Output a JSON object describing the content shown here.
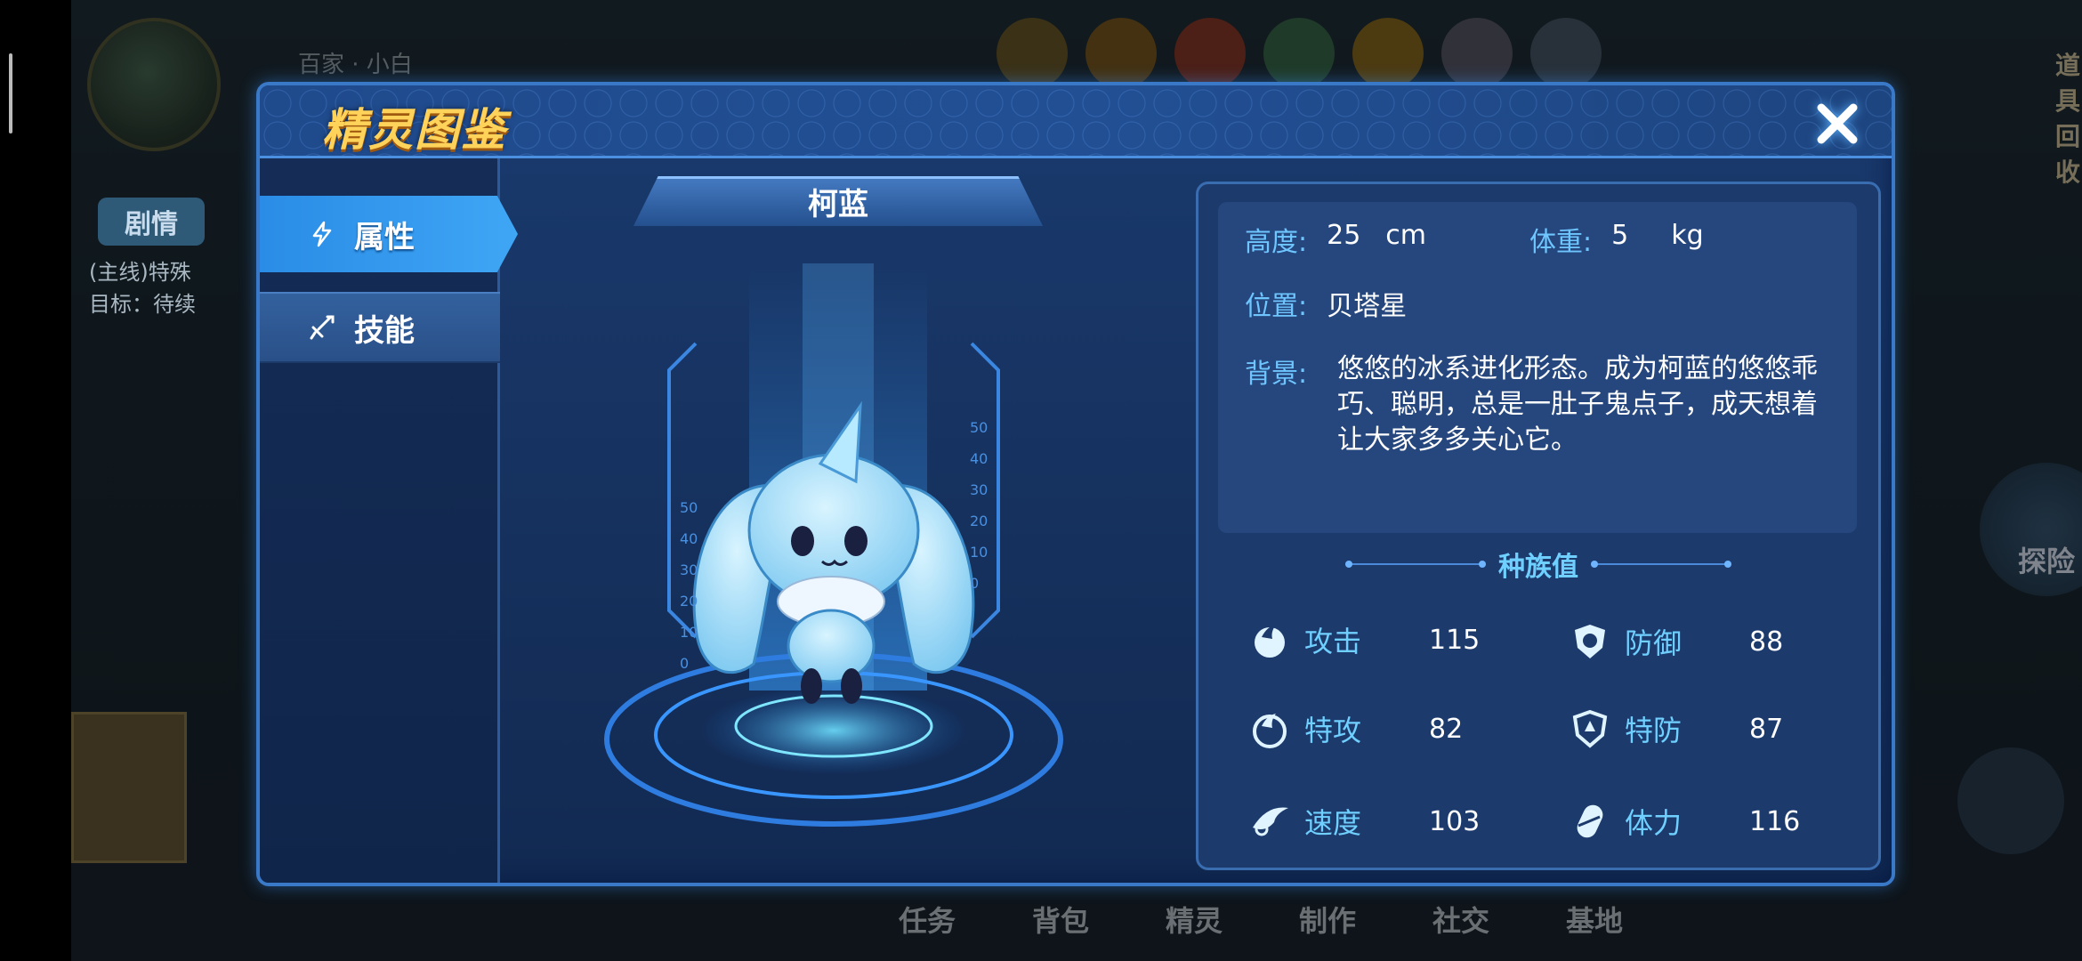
{
  "background": {
    "username": "百家 · 小白",
    "plot_button": "剧情",
    "task_lines": [
      "(主线)特殊",
      "目标：待续"
    ],
    "tool_label": "道具回收",
    "explore_label": "探险",
    "bottom_nav": [
      "任务",
      "背包",
      "精灵",
      "制作",
      "社交",
      "基地"
    ]
  },
  "dialog": {
    "title": "精灵图鉴",
    "close_icon": "close-icon",
    "tabs": [
      {
        "label": "属性",
        "icon": "lightning-icon",
        "active": true
      },
      {
        "label": "技能",
        "icon": "sword-icon",
        "active": false
      }
    ]
  },
  "creature": {
    "name": "柯蓝",
    "scale_left": [
      "50",
      "40",
      "30",
      "20",
      "10",
      "0"
    ],
    "scale_right": [
      "50",
      "40",
      "30",
      "20",
      "10",
      "0"
    ]
  },
  "info": {
    "height_label": "高度:",
    "height_value": "25",
    "height_unit": "cm",
    "weight_label": "体重:",
    "weight_value": "5",
    "weight_unit": "kg",
    "location_label": "位置:",
    "location_value": "贝塔星",
    "background_label": "背景:",
    "background_text": "悠悠的冰系进化形态。成为柯蓝的悠悠乖巧、聪明，总是一肚子鬼点子，成天想着让大家多多关心它。",
    "stats_title": "种族值",
    "stats": [
      {
        "name": "攻击",
        "value": "115",
        "icon": "attack-icon"
      },
      {
        "name": "防御",
        "value": "88",
        "icon": "defense-icon"
      },
      {
        "name": "特攻",
        "value": "82",
        "icon": "special-attack-icon"
      },
      {
        "name": "特防",
        "value": "87",
        "icon": "special-defense-icon"
      },
      {
        "name": "速度",
        "value": "103",
        "icon": "speed-icon"
      },
      {
        "name": "体力",
        "value": "116",
        "icon": "stamina-icon"
      }
    ]
  },
  "colors": {
    "accent": "#3fa6f5",
    "title_gold": "#ffd35a",
    "label_cyan": "#6fc6ff"
  }
}
